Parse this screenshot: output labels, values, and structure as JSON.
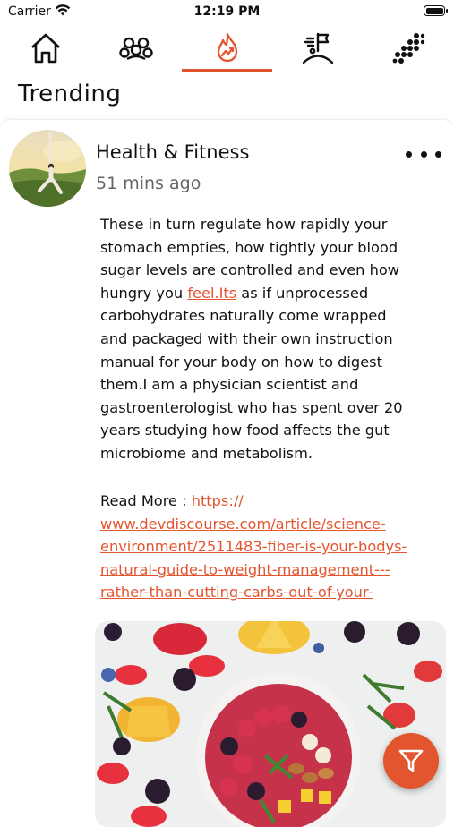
{
  "status_bar": {
    "carrier": "Carrier",
    "time": "12:19 PM"
  },
  "tabs": [
    {
      "name": "home",
      "icon": "home-icon"
    },
    {
      "name": "groups",
      "icon": "group-icon"
    },
    {
      "name": "trending",
      "icon": "flame-trending-icon",
      "active": true
    },
    {
      "name": "goals",
      "icon": "flag-person-icon"
    },
    {
      "name": "more",
      "icon": "dots-grid-icon"
    }
  ],
  "page": {
    "title": "Trending"
  },
  "post": {
    "author": "Health & Fitness",
    "time": "51 mins ago",
    "body_lines": [
      "These in turn regulate how rapidly your",
      "stomach empties, how tightly your blood",
      "sugar levels are controlled and even how"
    ],
    "body_hungry_prefix": "hungry you ",
    "body_link_text": "feel.Its",
    "body_hungry_suffix": " as if unprocessed",
    "body_lines_after": [
      "carbohydrates naturally come wrapped",
      "and packaged with their own instruction",
      "manual for your body on how to digest",
      "them.I am a physician scientist and",
      "gastroenterologist who has spent over 20",
      "years studying how food affects the gut",
      "microbiome and metabolism."
    ],
    "read_more_label": "Read More : ",
    "read_more_url_lines": [
      "https://",
      "www.devdiscourse.com/article/science-",
      "environment/2511483-fiber-is-your-bodys-",
      "natural-guide-to-weight-management---",
      "rather-than-cutting-carbs-out-of-your-"
    ]
  },
  "colors": {
    "accent": "#e2552f",
    "text": "#111111",
    "muted": "#666666"
  }
}
